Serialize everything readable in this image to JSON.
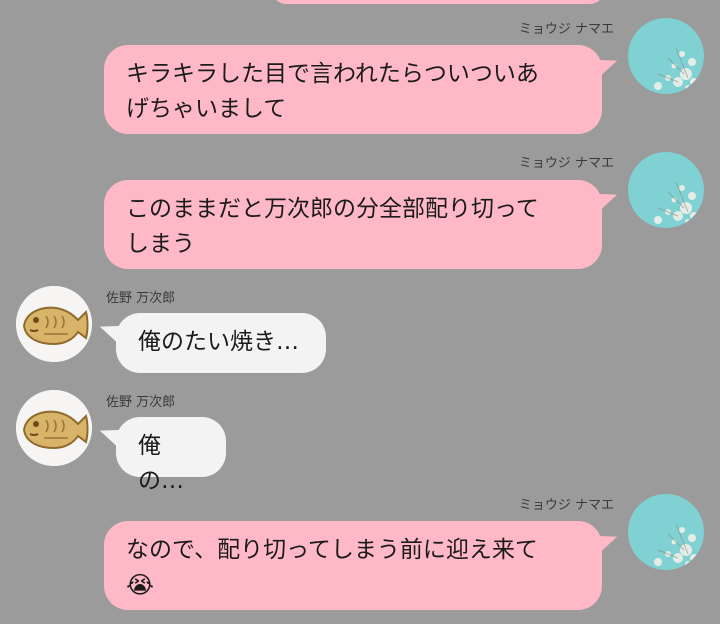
{
  "chat": {
    "messages": [
      {
        "sender": "ミョウジ ナマエ",
        "side": "right",
        "text": "キラキラした目で言われたらついついあ\nげちゃいまして"
      },
      {
        "sender": "ミョウジ ナマエ",
        "side": "right",
        "text": "このままだと万次郎の分全部配り切って\nしまう"
      },
      {
        "sender": "佐野 万次郎",
        "side": "left",
        "text": "俺のたい焼き…"
      },
      {
        "sender": "佐野 万次郎",
        "side": "left",
        "text": "俺の…"
      },
      {
        "sender": "ミョウジ ナマエ",
        "side": "right",
        "text": "なので、配り切ってしまう前に迎え来て",
        "emoji": "😭"
      }
    ]
  },
  "avatars": {
    "mine": "flowers-avatar",
    "theirs": "taiyaki-avatar"
  },
  "colors": {
    "background": "#9b9b9b",
    "my_bubble": "#ffb8c6",
    "their_bubble": "#f3f3f3"
  }
}
